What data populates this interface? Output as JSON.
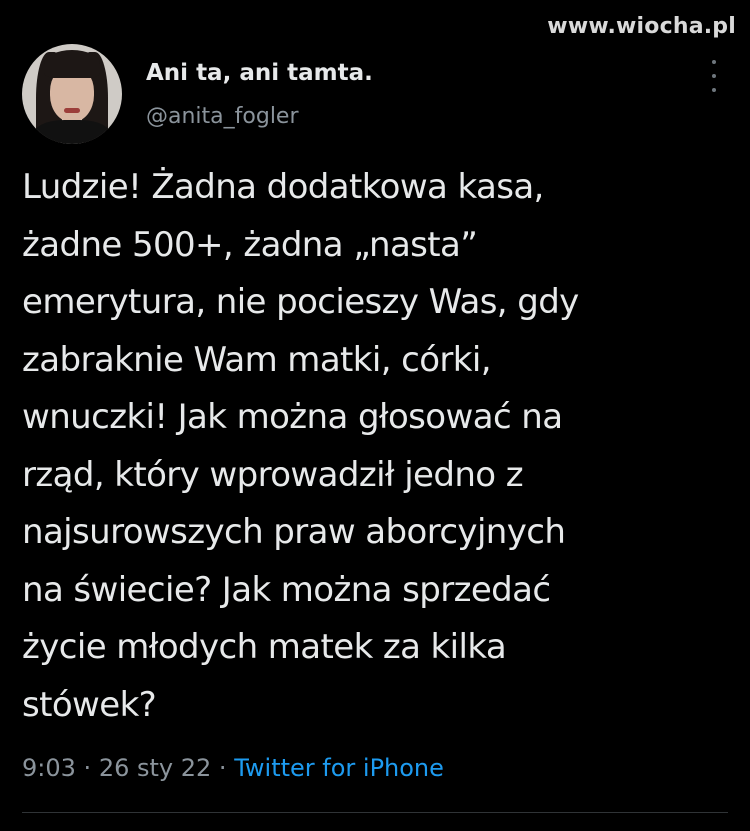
{
  "watermark": "www.wiocha.pl",
  "tweet": {
    "author": {
      "display_name": "Ani ta, ani tamta.",
      "handle": "@anita_fogler",
      "avatar_icon": "user-avatar"
    },
    "more_icon": "more-vertical-icon",
    "text": "Ludzie! Żadna dodatkowa kasa,\nżadne 500+, żadna „nasta”\nemerytura, nie pocieszy Was, gdy\nzabraknie Wam matki, córki,\nwnuczki! Jak można głosować na\nrząd, który wprowadził jedno z\nnajsurowszych praw aborcyjnych\nna świecie? Jak można sprzedać\nżycie młodych matek za kilka\nstówek?",
    "time": "9:03",
    "separator": "·",
    "date": "26 sty 22",
    "source": "Twitter for iPhone"
  },
  "colors": {
    "background": "#000000",
    "text": "#e7e9ea",
    "muted": "#8b949c",
    "link": "#1d9bf0"
  }
}
